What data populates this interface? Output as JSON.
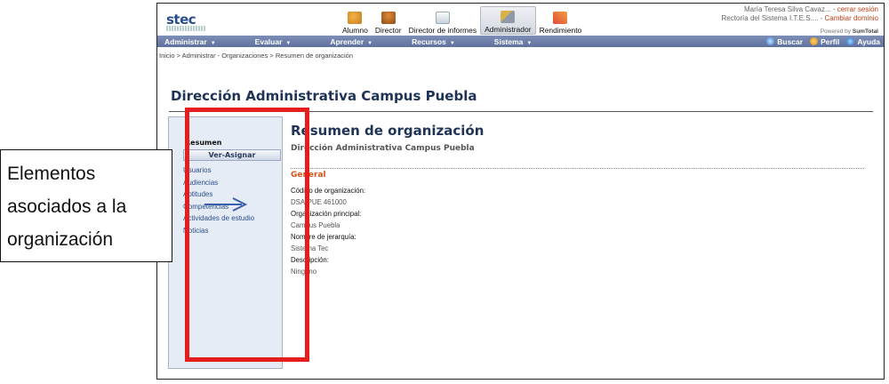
{
  "header": {
    "roles": [
      {
        "label": "Alumno",
        "icon": "student-icon"
      },
      {
        "label": "Director",
        "icon": "director-icon"
      },
      {
        "label": "Director de informes",
        "icon": "report-icon"
      },
      {
        "label": "Administrador",
        "icon": "admin-tools-icon"
      },
      {
        "label": "Rendimiento",
        "icon": "performance-icon"
      }
    ],
    "active_role": "Administrador",
    "user_name": "María Teresa Silva Cavaz...",
    "sep": " - ",
    "logout_link": "cerrar sesión",
    "domain": "Rectoría del Sistema I.T.E.S....",
    "change_domain": "Cambiar dominio",
    "powered_by_prefix": "Powered by",
    "powered_by_brand": "SumTotal"
  },
  "nav": {
    "items": [
      "Administrar",
      "Evaluar",
      "Aprender",
      "Recursos",
      "Sistema"
    ],
    "right": [
      {
        "label": "Buscar",
        "icon": "search-icon"
      },
      {
        "label": "Perfil",
        "icon": "profile-icon"
      },
      {
        "label": "Ayuda",
        "icon": "help-icon"
      }
    ]
  },
  "breadcrumb": "Inicio > Administrar - Organizaciones > Resumen de organización",
  "page_title": "Dirección Administrativa Campus Puebla",
  "left_panel": {
    "title": "Resumen",
    "button": "Ver-Asignar",
    "items": [
      "Usuarios",
      "Audiencias",
      "Aptitudes",
      "Competencias",
      "Actividades de estudio",
      "Noticias"
    ]
  },
  "content": {
    "heading": "Resumen de organización",
    "subheading": "Dirección Administrativa Campus Puebla",
    "section": "General",
    "fields": [
      {
        "label": "Código de organización:",
        "value": "DSA-PUE 461000"
      },
      {
        "label": "Organización principal:",
        "value": "Campus Puebla"
      },
      {
        "label": "Nombre de jerarquía:",
        "value": "Sistema Tec"
      },
      {
        "label": "Descripción:",
        "value": "Ninguno"
      }
    ]
  },
  "callout": {
    "lines": [
      "Elementos",
      "asociados a la",
      "organización"
    ]
  },
  "colors": {
    "annotation_red": "#e51d1d",
    "nav_blue": "#6b7ea8",
    "section_orange": "#d8531a"
  }
}
